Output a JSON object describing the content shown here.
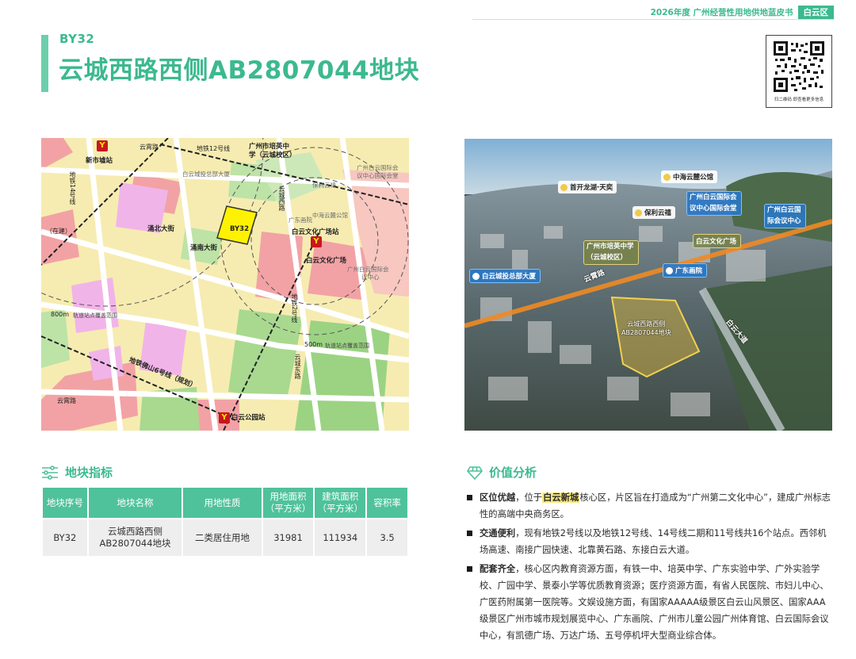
{
  "header": {
    "series": "2026年度 广州经营性用地供地蓝皮书",
    "district": "白云区"
  },
  "plot": {
    "code": "BY32",
    "title": "云城西路西侧AB2807044地块"
  },
  "qr": {
    "caption": "扫二维码 即查看更多信息"
  },
  "map": {
    "labels": {
      "xinshixu": "新市墟站",
      "yunxiao": "云霄路",
      "line12": "地铁12号线",
      "peiying_1": "广州市培英中",
      "peiying_2": "学（云城校区）",
      "baiyun_invest": "白云城投总部大厦",
      "baiyun_intl_1": "广州白云国际会",
      "baiyun_intl_2": "议中心国际会堂",
      "baoli": "保利云禧",
      "zhonghai": "中海云麓公馆",
      "guangdong_art": "广东画院",
      "line14": "地铁14号线",
      "zai_jian": "（在建）",
      "yuncheng_west": "云城西路",
      "yongbei": "涌北大街",
      "yongnan": "涌南大街",
      "plot_code": "BY32",
      "wenhua_station": "白云文化广场站",
      "wenhua_plaza": "白云文化广场",
      "intl_center_1": "广州白云国际会",
      "intl_center_2": "议中心",
      "metro2": "地铁2号线",
      "ring800_num": "800m",
      "ring800": "轨道站点覆盖范围",
      "ring500_num": "500m",
      "ring500": "轨道站点覆盖范围",
      "line6": "地铁佛山6号线（规划）",
      "yuncheng_east": "云城东路",
      "yunxiao_road": "云霄路",
      "park_station": "白云公园站"
    }
  },
  "photo": {
    "tags": {
      "longhu": "首开龙湖·天奕",
      "zhonghai": "中海云麓公馆",
      "baoli": "保利云禧",
      "intl_hall_1": "广州白云国际会",
      "intl_hall_2": "议中心国际会堂",
      "intl_center_1": "广州白云国",
      "intl_center_2": "际会议中心",
      "peiying_1": "广州市培英中学",
      "peiying_2": "（云城校区）",
      "wenhua": "白云文化广场",
      "invest": "白云城投总部大厦",
      "art": "广东画院"
    },
    "streets": {
      "yunxiao": "云霄路",
      "baiyun_ave": "白云大道"
    },
    "plot_1": "云城西路西侧",
    "plot_2": "AB2807044地块"
  },
  "metrics": {
    "heading": "地块指标",
    "columns": [
      "地块序号",
      "地块名称",
      "用地性质",
      "用地面积\n（平方米）",
      "建筑面积\n（平方米）",
      "容积率"
    ],
    "row": {
      "code": "BY32",
      "name_1": "云城西路西侧",
      "name_2": "AB2807044地块",
      "nature": "二类居住用地",
      "land_area": "31981",
      "floor_area": "111934",
      "far": "3.5"
    }
  },
  "analysis": {
    "heading": "价值分析",
    "item1": {
      "title": "区位优越",
      "pre": "，位于",
      "highlight": "白云新城",
      "post": "核心区，片区旨在打造成为“广州第二文化中心”，建成广州标志性的高端中央商务区。"
    },
    "item2": {
      "title": "交通便利",
      "text": "，现有地铁2号线以及地铁12号线、14号线二期和11号线共16个站点。西邻机场高速、南接广园快速、北靠黄石路、东接白云大道。"
    },
    "item3": {
      "title": "配套齐全",
      "text": "，核心区内教育资源方面，有铁一中、培英中学、广东实验中学、广外实验学校、广园中学、景泰小学等优质教育资源；医疗资源方面，有省人民医院、市妇儿中心、广医药附属第一医院等。文娱设施方面，有国家AAAAA级景区白云山风景区、国家AAA级景区广州市城市规划展览中心、广东画院、广州市儿童公园广州体育馆、白云国际会议中心，有凯德广场、万达广场、五号停机坪大型商业综合体。"
    }
  }
}
